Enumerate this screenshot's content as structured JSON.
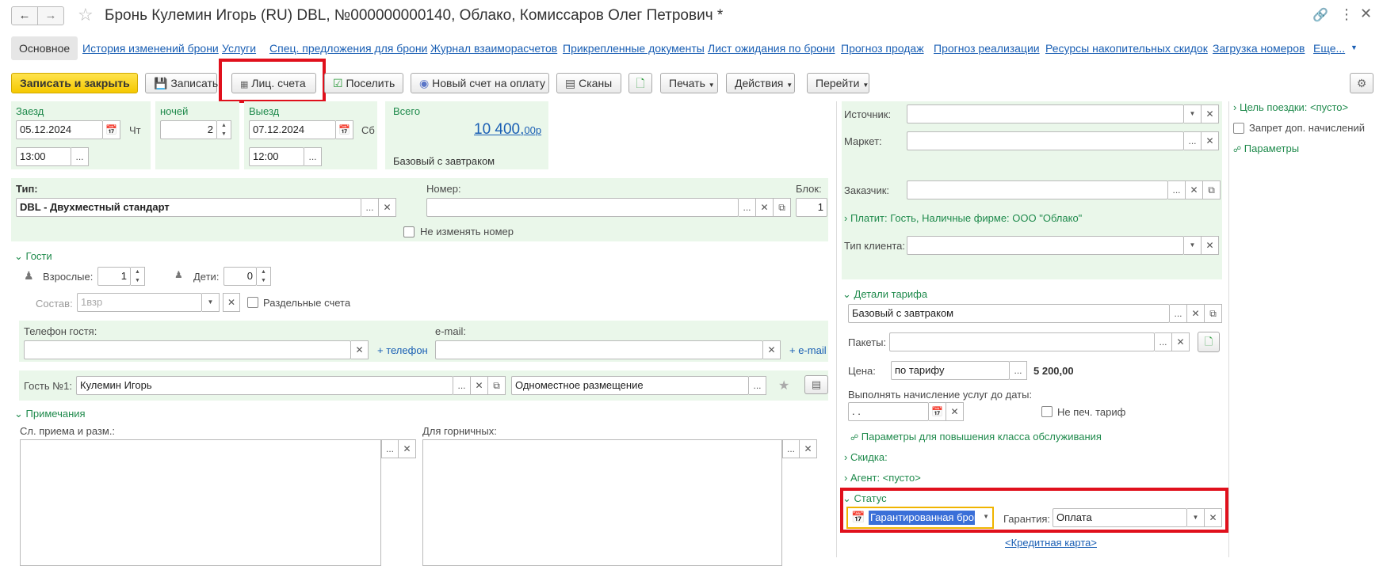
{
  "header": {
    "title": "Бронь Кулемин Игорь (RU) DBL, №000000000140, Облако, Комиссаров Олег Петрович *",
    "back_icon": "arrow-left-icon",
    "forward_icon": "arrow-right-icon",
    "star_icon": "star-icon",
    "link_icon": "link-icon",
    "menu_icon": "kebab-icon",
    "close_icon": "close-icon"
  },
  "tabs": [
    "Основное",
    "История изменений брони",
    "Услуги",
    "Спец. предложения для брони",
    "Журнал взаиморасчетов",
    "Прикрепленные документы",
    "Лист ожидания по брони",
    "Прогноз продаж",
    "Прогноз реализации",
    "Ресурсы накопительных скидок",
    "Загрузка номеров",
    "Еще..."
  ],
  "toolbar": {
    "save_close": "Записать и закрыть",
    "save": "Записать",
    "accounts": "Лиц. счета",
    "checkin": "Поселить",
    "new_invoice": "Новый счет на оплату",
    "scans": "Сканы",
    "print": "Печать",
    "actions": "Действия",
    "goto": "Перейти"
  },
  "dates": {
    "arrival_label": "Заезд",
    "arrival_date": "05.12.2024",
    "arrival_dow": "Чт",
    "arrival_time": "13:00",
    "nights_label": "ночей",
    "nights": "2",
    "departure_label": "Выезд",
    "departure_date": "07.12.2024",
    "departure_dow": "Сб",
    "departure_time": "12:00",
    "total_label": "Всего",
    "total_main": "10 400,",
    "total_cents": "00р",
    "rate_name": "Базовый с завтраком"
  },
  "room": {
    "type_label": "Тип:",
    "type_value": "DBL - Двухместный стандарт",
    "number_label": "Номер:",
    "number_value": "",
    "block_label": "Блок:",
    "block_value": "1",
    "no_change_label": "Не изменять номер"
  },
  "guests": {
    "section_label": "Гости",
    "adults_label": "Взрослые:",
    "adults": "1",
    "children_label": "Дети:",
    "children": "0",
    "composition_label": "Состав:",
    "composition_placeholder": "1взр",
    "separate_accounts_label": "Раздельные счета",
    "phone_label": "Телефон гостя:",
    "add_phone": "+ телефон",
    "email_label": "e-mail:",
    "add_email": "+ e-mail",
    "guest1_label": "Гость №1:",
    "guest1_name": "Кулемин Игорь",
    "guest1_accommodation": "Одноместное размещение"
  },
  "notes": {
    "section_label": "Примечания",
    "reception_label": "Сл. приема и разм.:",
    "housekeeping_label": "Для горничных:"
  },
  "right": {
    "source_label": "Источник:",
    "market_label": "Маркет:",
    "customer_label": "Заказчик:",
    "payer_text": "Платит: Гость, Наличные фирме: ООО \"Облако\"",
    "client_type_label": "Тип клиента:",
    "tariff_section": "Детали тарифа",
    "tariff_value": "Базовый с завтраком",
    "packages_label": "Пакеты:",
    "price_label": "Цена:",
    "price_mode": "по тарифу",
    "price_value": "5 200,00",
    "charge_until_label": "Выполнять начисление услуг до даты:",
    "charge_until_value": " .  .",
    "no_print_tariff_label": "Не печ. тариф",
    "upgrade_params": "Параметры для повышения класса обслуживания",
    "discount_label": "Скидка:",
    "agent_label": "Агент: <пусто>",
    "status_section": "Статус",
    "status_value": "Гарантированная бронь",
    "guarantee_label": "Гарантия:",
    "guarantee_value": "Оплата",
    "credit_card_link": "<Кредитная карта>"
  },
  "side": {
    "trip_goal": "Цель поездки: <пусто>",
    "extra_charges_ban": "Запрет доп. начислений",
    "params": "Параметры"
  }
}
